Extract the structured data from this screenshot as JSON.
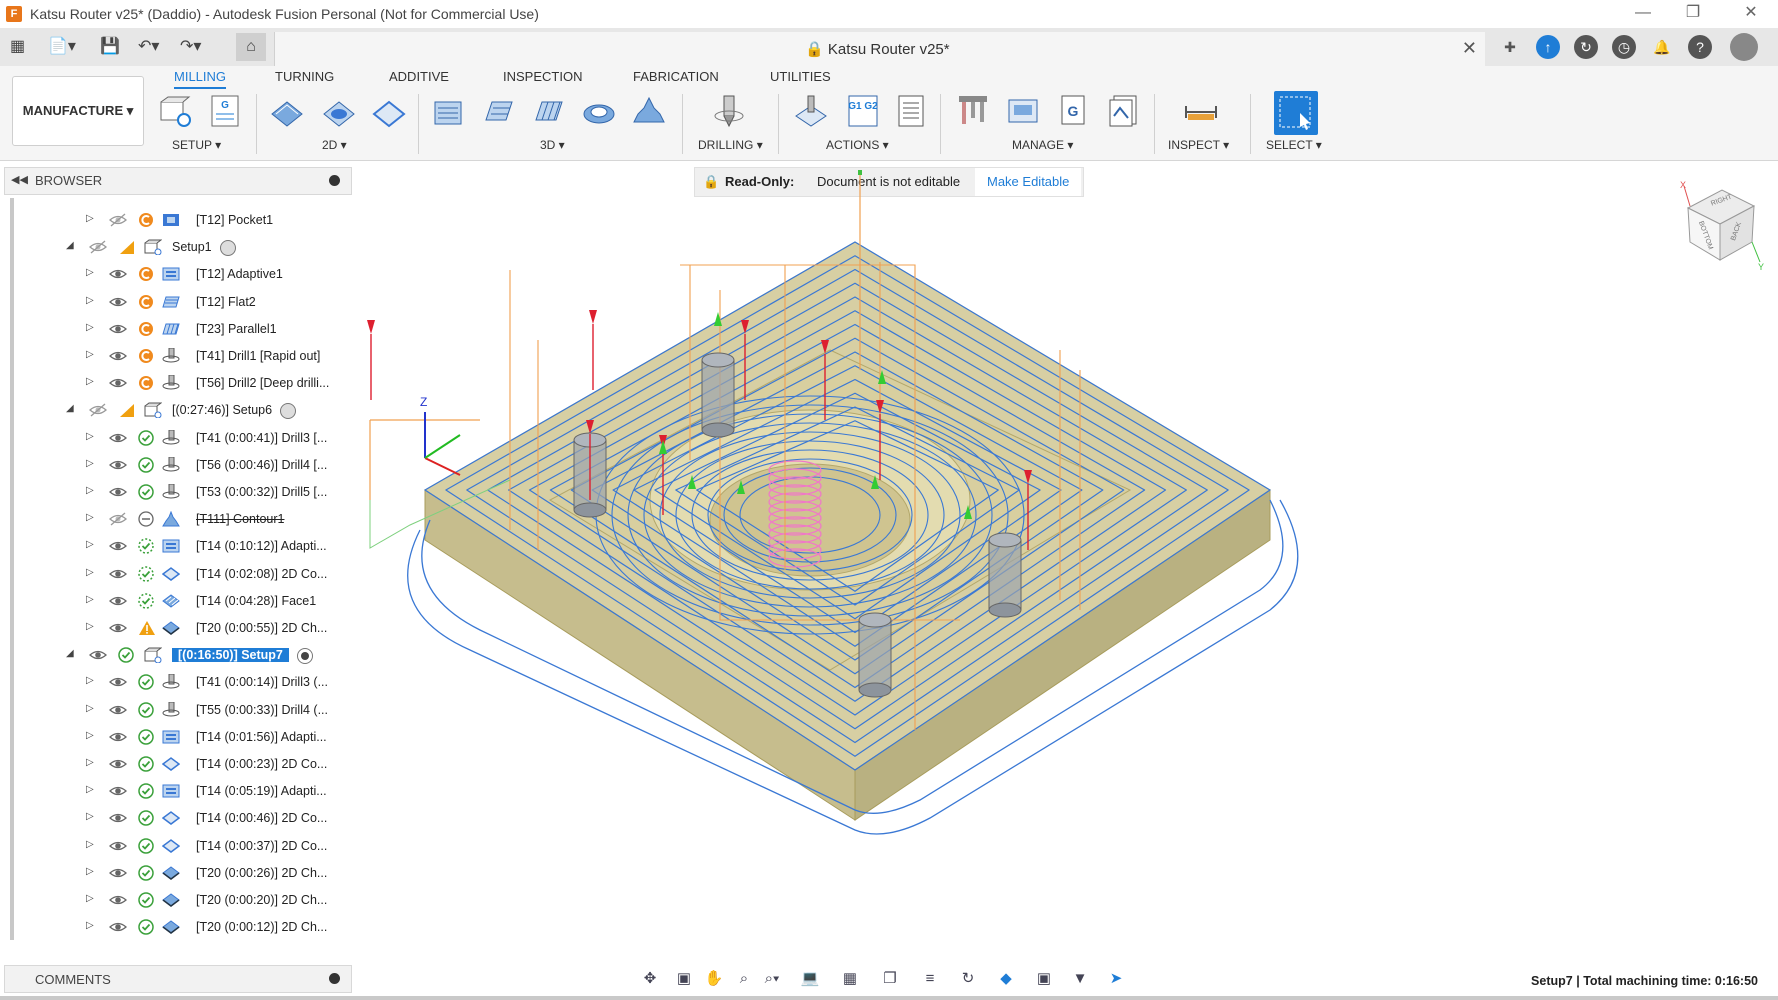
{
  "window": {
    "title": "Katsu Router v25* (Daddio) - Autodesk Fusion Personal (Not for Commercial Use)"
  },
  "document_tab": {
    "name": "Katsu Router v25*"
  },
  "workspace": {
    "label": "MANUFACTURE"
  },
  "ribbon": {
    "tabs": [
      "MILLING",
      "TURNING",
      "ADDITIVE",
      "INSPECTION",
      "FABRICATION",
      "UTILITIES"
    ],
    "active_tab": "MILLING",
    "groups": [
      "SETUP",
      "2D",
      "3D",
      "DRILLING",
      "ACTIONS",
      "MANAGE",
      "INSPECT",
      "SELECT"
    ],
    "g1g2_text": "G1 G2"
  },
  "browser": {
    "title": "BROWSER",
    "rows": [
      {
        "label": "[T12] Pocket1"
      },
      {
        "label": "Setup1"
      },
      {
        "label": "[T12] Adaptive1"
      },
      {
        "label": "[T12] Flat2"
      },
      {
        "label": "[T23] Parallel1"
      },
      {
        "label": "[T41] Drill1 [Rapid out]"
      },
      {
        "label": "[T56] Drill2 [Deep drilli..."
      },
      {
        "label": "[(0:27:46)] Setup6"
      },
      {
        "label": "[T41 (0:00:41)] Drill3 [..."
      },
      {
        "label": "[T56 (0:00:46)] Drill4 [..."
      },
      {
        "label": "[T53 (0:00:32)] Drill5 [..."
      },
      {
        "label": "[T111] Contour1"
      },
      {
        "label": "[T14 (0:10:12)] Adapti..."
      },
      {
        "label": "[T14 (0:02:08)] 2D Co..."
      },
      {
        "label": "[T14 (0:04:28)] Face1"
      },
      {
        "label": "[T20 (0:00:55)] 2D Ch..."
      },
      {
        "label": "[(0:16:50)] Setup7"
      },
      {
        "label": "[T41 (0:00:14)] Drill3 (..."
      },
      {
        "label": "[T55 (0:00:33)] Drill4 (..."
      },
      {
        "label": "[T14 (0:01:56)] Adapti..."
      },
      {
        "label": "[T14 (0:00:23)] 2D Co..."
      },
      {
        "label": "[T14 (0:05:19)] Adapti..."
      },
      {
        "label": "[T14 (0:00:46)] 2D Co..."
      },
      {
        "label": "[T14 (0:00:37)] 2D Co..."
      },
      {
        "label": "[T20 (0:00:26)] 2D Ch..."
      },
      {
        "label": "[T20 (0:00:20)] 2D Ch..."
      },
      {
        "label": "[T20 (0:00:12)] 2D Ch..."
      }
    ]
  },
  "readonly_banner": {
    "label": "Read-Only:",
    "message": "Document is not editable",
    "action": "Make Editable"
  },
  "viewcube": {
    "faces": [
      "RIGHT",
      "BACK",
      "BOTTOM"
    ],
    "axis_x": "X",
    "axis_y": "Y"
  },
  "axis_triad": {
    "z": "Z"
  },
  "comments": {
    "label": "COMMENTS"
  },
  "status": {
    "setup": "Setup7",
    "separator": " | ",
    "text": "Total machining time: 0:16:50"
  },
  "colors": {
    "accent": "#1f7dd6",
    "toolpath": "#3a78d4",
    "rapid": "#f0a050",
    "stock": "#c9bf84"
  }
}
